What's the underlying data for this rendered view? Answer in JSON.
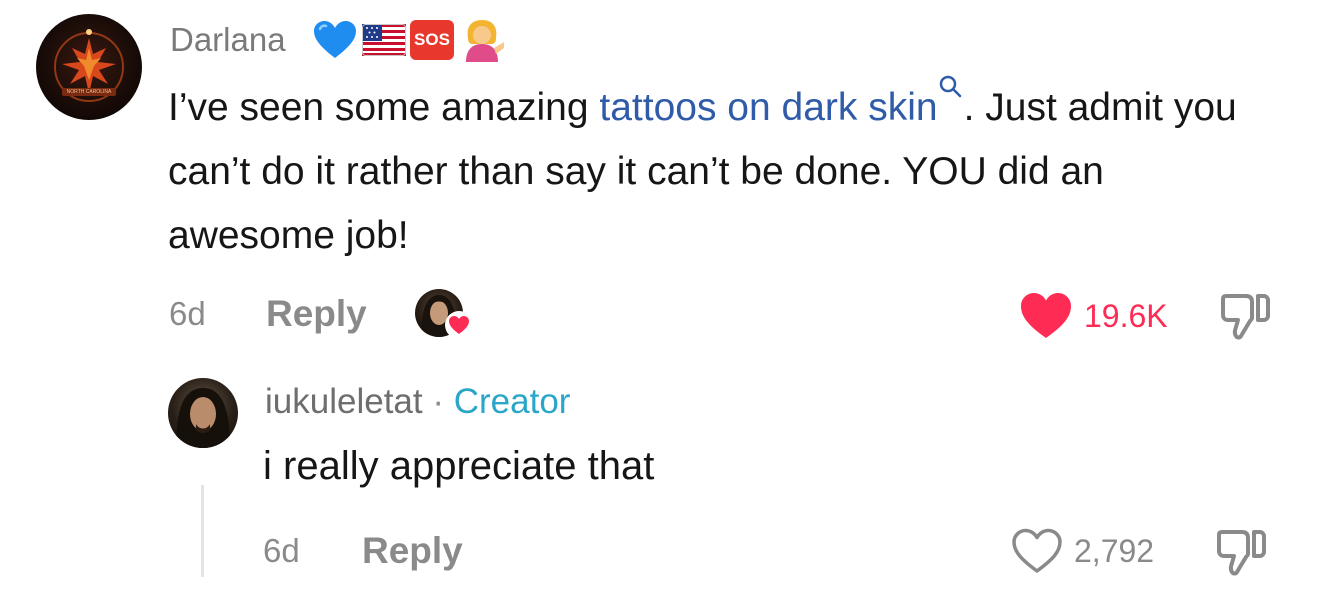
{
  "comment": {
    "username": "Darlana",
    "badges": [
      "blue-heart",
      "us-flag",
      "sos",
      "person-tipping-hand"
    ],
    "sos_label": "SOS",
    "avatar_caption": "NORTH CAROLINA",
    "text_before_link": "I’ve seen some amazing ",
    "link_text": "tattoos on dark skin",
    "text_after_link": ". Just admit you can’t do it rather than say it can’t be done. YOU did an awesome job!",
    "time": "6d",
    "reply_label": "Reply",
    "like_count": "19.6K",
    "liked_by_creator": true,
    "liked": true
  },
  "reply": {
    "username": "iukuleletat",
    "separator": "·",
    "role": "Creator",
    "text": "i really appreciate that",
    "time": "6d",
    "reply_label": "Reply",
    "like_count": "2,792",
    "liked": false
  },
  "colors": {
    "like_red": "#fe2c55",
    "link_blue": "#2f5ba8",
    "creator_teal": "#2aa6c8",
    "muted_gray": "#8a8a8a"
  }
}
